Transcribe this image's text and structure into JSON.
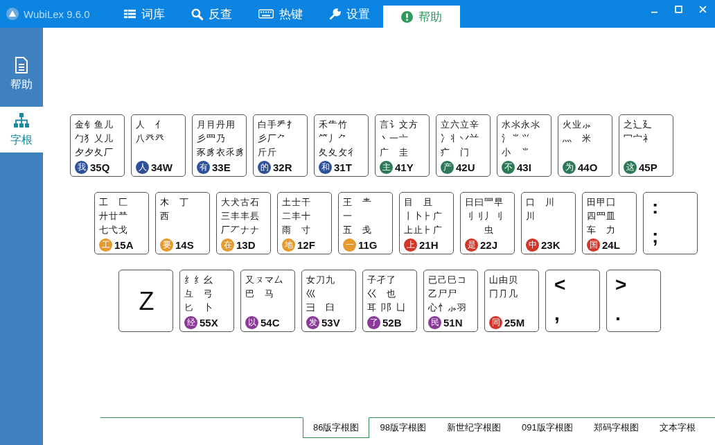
{
  "window": {
    "title": "WubiLex 9.6.0"
  },
  "tabs": [
    {
      "label": "词库",
      "kind": "library",
      "selected": false
    },
    {
      "label": "反查",
      "kind": "search",
      "selected": false
    },
    {
      "label": "热键",
      "kind": "hotkey",
      "selected": false
    },
    {
      "label": "设置",
      "kind": "settings",
      "selected": false
    },
    {
      "label": "帮助",
      "kind": "help",
      "selected": true
    }
  ],
  "sidebar": {
    "items": [
      {
        "label": "帮助",
        "kind": "document",
        "selected": false
      },
      {
        "label": "字根",
        "kind": "tree",
        "selected": true
      }
    ]
  },
  "keyboard": {
    "rows": [
      {
        "keys": [
          {
            "kind": "roots",
            "lines": [
              "金钅鱼儿",
              "勹犭乂儿",
              "夕夕夂厂"
            ],
            "badge": "我",
            "code": "35Q",
            "color": "#2f4f98"
          },
          {
            "kind": "roots",
            "lines": [
              "人　亻",
              "八癶癶"
            ],
            "badge": "人",
            "code": "34W",
            "color": "#2f4f98"
          },
          {
            "kind": "roots",
            "lines": [
              "月⺝丹用",
              "彡罒乃",
              "豕豸衣乑豸"
            ],
            "badge": "有",
            "code": "33E",
            "color": "#2f4f98"
          },
          {
            "kind": "roots",
            "lines": [
              "白手龵扌",
              "彡厂⺈",
              "斤斤"
            ],
            "badge": "的",
            "code": "32R",
            "color": "#2f4f98"
          },
          {
            "kind": "roots",
            "lines": [
              "禾⺧竹",
              "⺮丿⺈",
              "夂夊攵彳"
            ],
            "badge": "和",
            "code": "31T",
            "color": "#2f4f98"
          },
          {
            "kind": "roots",
            "lines": [
              "言讠文方",
              "丶一亠",
              "广　圭"
            ],
            "badge": "主",
            "code": "41Y",
            "color": "#2d7a58"
          },
          {
            "kind": "roots",
            "lines": [
              "立六立辛",
              "冫丬丷䒑",
              "疒　门"
            ],
            "badge": "产",
            "code": "42U",
            "color": "#2d7a58"
          },
          {
            "kind": "roots",
            "lines": [
              "水氺永⺢",
              "氵⺌⺍",
              "小　⺌"
            ],
            "badge": "不",
            "code": "43I",
            "color": "#2d7a58"
          },
          {
            "kind": "roots",
            "lines": [
              "火业⺗",
              "灬　米"
            ],
            "badge": "为",
            "code": "44O",
            "color": "#2d7a58"
          },
          {
            "kind": "roots",
            "lines": [
              "之辶廴",
              "冖宀礻"
            ],
            "badge": "这",
            "code": "45P",
            "color": "#2d7a58"
          }
        ]
      },
      {
        "keys": [
          {
            "kind": "roots",
            "lines": [
              "工　匚",
              "廾廿龷",
              "七弋戈"
            ],
            "badge": "工",
            "code": "15A",
            "color": "#e69a2e"
          },
          {
            "kind": "roots",
            "lines": [
              "木　丁",
              "西"
            ],
            "badge": "要",
            "code": "14S",
            "color": "#e69a2e"
          },
          {
            "kind": "roots",
            "lines": [
              "大犬古石",
              "三丰丰镸",
              "厂丆ナナ"
            ],
            "badge": "在",
            "code": "13D",
            "color": "#e69a2e"
          },
          {
            "kind": "roots",
            "lines": [
              "土士干",
              "二丰十",
              "雨　寸"
            ],
            "badge": "地",
            "code": "12F",
            "color": "#e69a2e"
          },
          {
            "kind": "roots",
            "lines": [
              "王　龶",
              "一",
              "五　戋"
            ],
            "badge": "一",
            "code": "11G",
            "color": "#e69a2e"
          },
          {
            "kind": "roots",
            "lines": [
              "目　且",
              "丨卜⺊广",
              "上止⺊广"
            ],
            "badge": "上",
            "code": "21H",
            "color": "#d2362a"
          },
          {
            "kind": "roots",
            "lines": [
              "日曰⺜早",
              "刂刂丿刂",
              "　　虫"
            ],
            "badge": "是",
            "code": "22J",
            "color": "#d2362a"
          },
          {
            "kind": "roots",
            "lines": [
              "口　川",
              "川"
            ],
            "badge": "中",
            "code": "23K",
            "color": "#d2362a"
          },
          {
            "kind": "roots",
            "lines": [
              "田甲囗",
              "四罒皿",
              "车　力"
            ],
            "badge": "国",
            "code": "24L",
            "color": "#d2362a"
          },
          {
            "kind": "symbol",
            "top": ":",
            "bottom": ";"
          }
        ]
      },
      {
        "keys": [
          {
            "kind": "letter",
            "label": "Z"
          },
          {
            "kind": "roots",
            "lines": [
              "纟纟幺",
              "彑　弓",
              "匕　卜"
            ],
            "badge": "经",
            "code": "55X",
            "color": "#8a3b9a"
          },
          {
            "kind": "roots",
            "lines": [
              "又ㄡマ厶",
              "巴　马"
            ],
            "badge": "以",
            "code": "54C",
            "color": "#8a3b9a"
          },
          {
            "kind": "roots",
            "lines": [
              "女刀九",
              "巛",
              "彐　臼"
            ],
            "badge": "发",
            "code": "53V",
            "color": "#8a3b9a"
          },
          {
            "kind": "roots",
            "lines": [
              "子孑了",
              "巜　也",
              "耳卩阝凵"
            ],
            "badge": "了",
            "code": "52B",
            "color": "#8a3b9a"
          },
          {
            "kind": "roots",
            "lines": [
              "已己巳コ",
              "乙尸尸",
              "心忄⺗羽"
            ],
            "badge": "民",
            "code": "51N",
            "color": "#8a3b9a"
          },
          {
            "kind": "roots",
            "lines": [
              "山由贝",
              "冂⺆几"
            ],
            "badge": "同",
            "code": "25M",
            "color": "#d2362a"
          },
          {
            "kind": "symbol",
            "top": "<",
            "bottom": ","
          },
          {
            "kind": "symbol",
            "top": ">",
            "bottom": "."
          }
        ]
      }
    ]
  },
  "chart_tabs": [
    {
      "label": "86版字根图",
      "selected": true
    },
    {
      "label": "98版字根图",
      "selected": false
    },
    {
      "label": "新世纪字根图",
      "selected": false
    },
    {
      "label": "091版字根图",
      "selected": false
    },
    {
      "label": "郑码字根图",
      "selected": false
    },
    {
      "label": "文本字根",
      "selected": false
    }
  ]
}
